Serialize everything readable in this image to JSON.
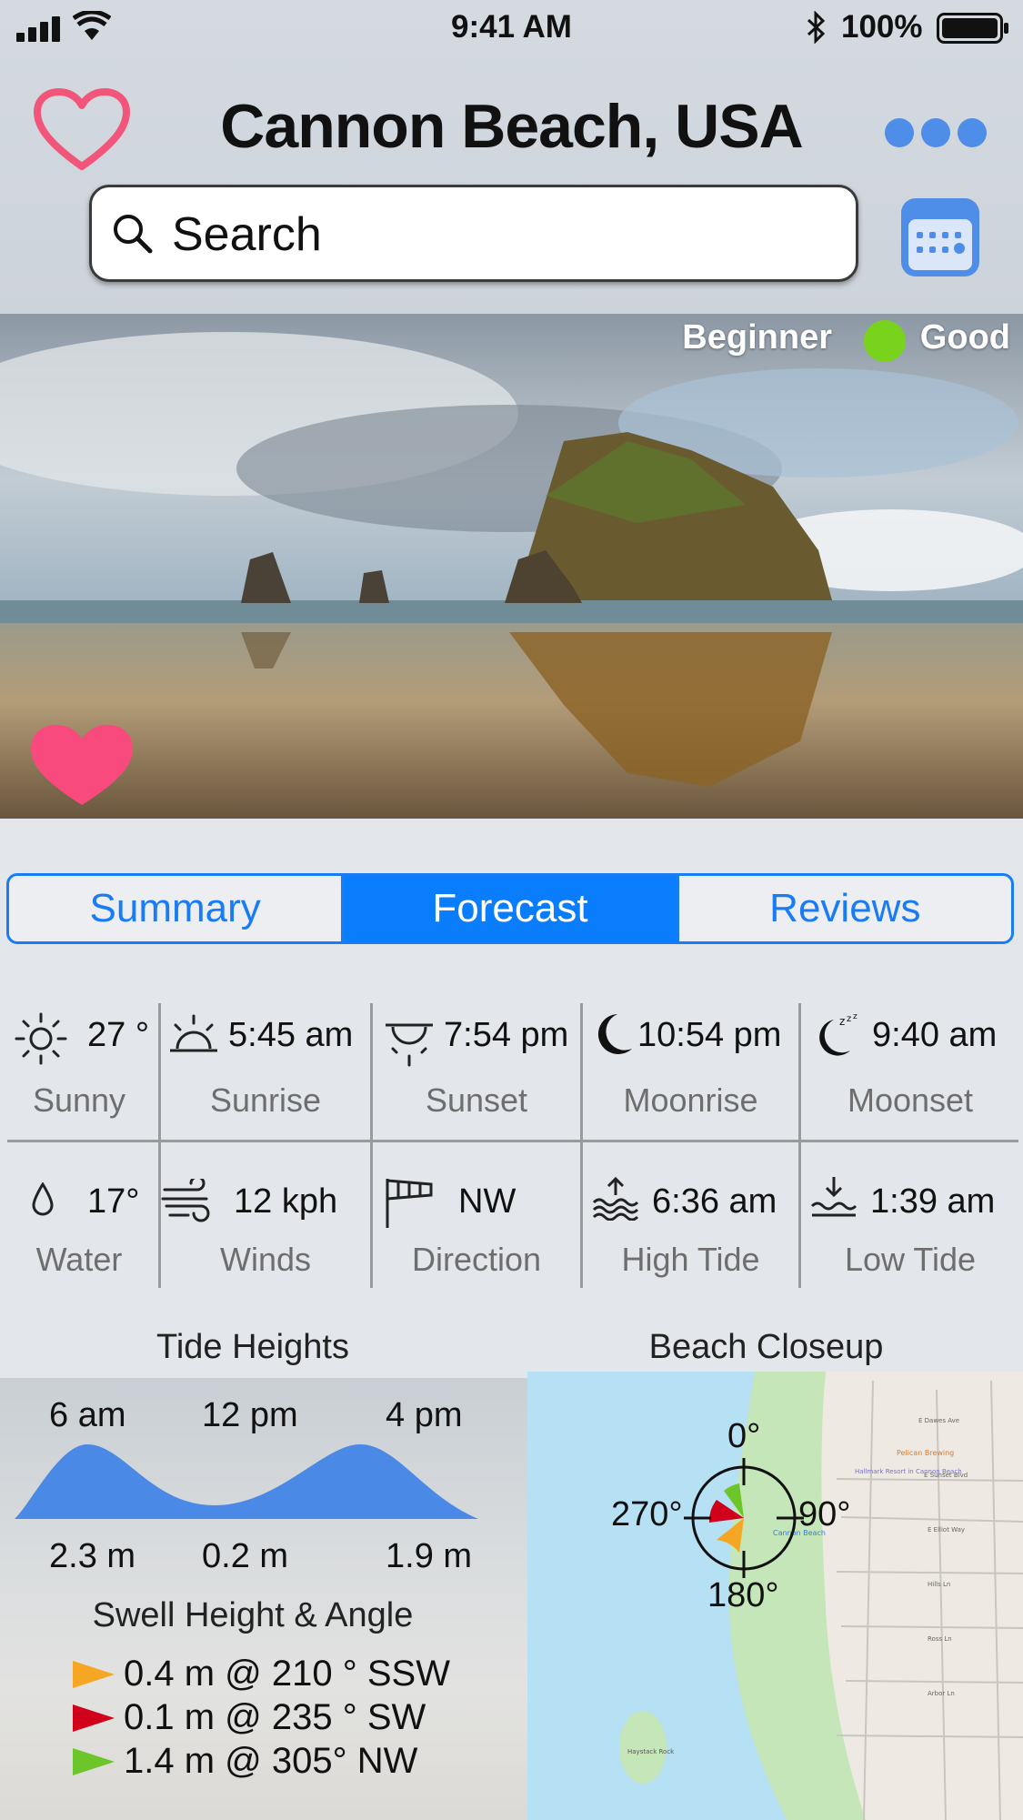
{
  "status_bar": {
    "time": "9:41 AM",
    "battery": "100%"
  },
  "header": {
    "title": "Cannon Beach, USA"
  },
  "search": {
    "placeholder": "Search"
  },
  "hero": {
    "level": "Beginner",
    "condition": "Good",
    "condition_color": "#79d21b"
  },
  "tabs": [
    {
      "label": "Summary",
      "active": false
    },
    {
      "label": "Forecast",
      "active": true
    },
    {
      "label": "Reviews",
      "active": false
    }
  ],
  "conditions": {
    "row1": [
      {
        "icon": "sun-icon",
        "value": "27 °",
        "label": "Sunny"
      },
      {
        "icon": "sunrise-icon",
        "value": "5:45 am",
        "label": "Sunrise"
      },
      {
        "icon": "sunset-icon",
        "value": "7:54 pm",
        "label": "Sunset"
      },
      {
        "icon": "moonrise-icon",
        "value": "10:54 pm",
        "label": "Moonrise"
      },
      {
        "icon": "moonset-icon",
        "value": "9:40 am",
        "label": "Moonset"
      }
    ],
    "row2": [
      {
        "icon": "water-drop-icon",
        "value": "17°",
        "label": "Water"
      },
      {
        "icon": "wind-icon",
        "value": "12 kph",
        "label": "Winds"
      },
      {
        "icon": "windsock-icon",
        "value": "NW",
        "label": "Direction"
      },
      {
        "icon": "high-tide-icon",
        "value": "6:36 am",
        "label": "High Tide"
      },
      {
        "icon": "low-tide-icon",
        "value": "1:39 am",
        "label": "Low Tide"
      }
    ]
  },
  "tide": {
    "title": "Tide Heights",
    "times": [
      "6 am",
      "12 pm",
      "4 pm"
    ],
    "heights": [
      "2.3 m",
      "0.2 m",
      "1.9 m"
    ],
    "values_m": [
      2.3,
      0.2,
      1.9
    ]
  },
  "swell": {
    "title": "Swell Height & Angle",
    "rows": [
      {
        "text": "0.4 m @ 210 ° SSW",
        "color": "#f5a623"
      },
      {
        "text": "0.1 m @ 235 ° SW",
        "color": "#d0021b"
      },
      {
        "text": "1.4 m @ 305° NW",
        "color": "#6cc62a"
      }
    ]
  },
  "map": {
    "title": "Beach Closeup",
    "compass": {
      "n": "0°",
      "e": "90°",
      "s": "180°",
      "w": "270°"
    },
    "labels": {
      "pelican": "Pelican Brewing",
      "hallmark": "Hallmark Resort in Cannon Beach",
      "cannon": "Cannon Beach",
      "haystack": "Haystack Rock",
      "sunset_blvd": "E Sunset Blvd",
      "dawes": "E Dawes Ave",
      "elliot": "E Elliot Way",
      "hills": "Hills Ln",
      "ross": "Ross Ln",
      "arbor": "Arbor Ln"
    }
  }
}
